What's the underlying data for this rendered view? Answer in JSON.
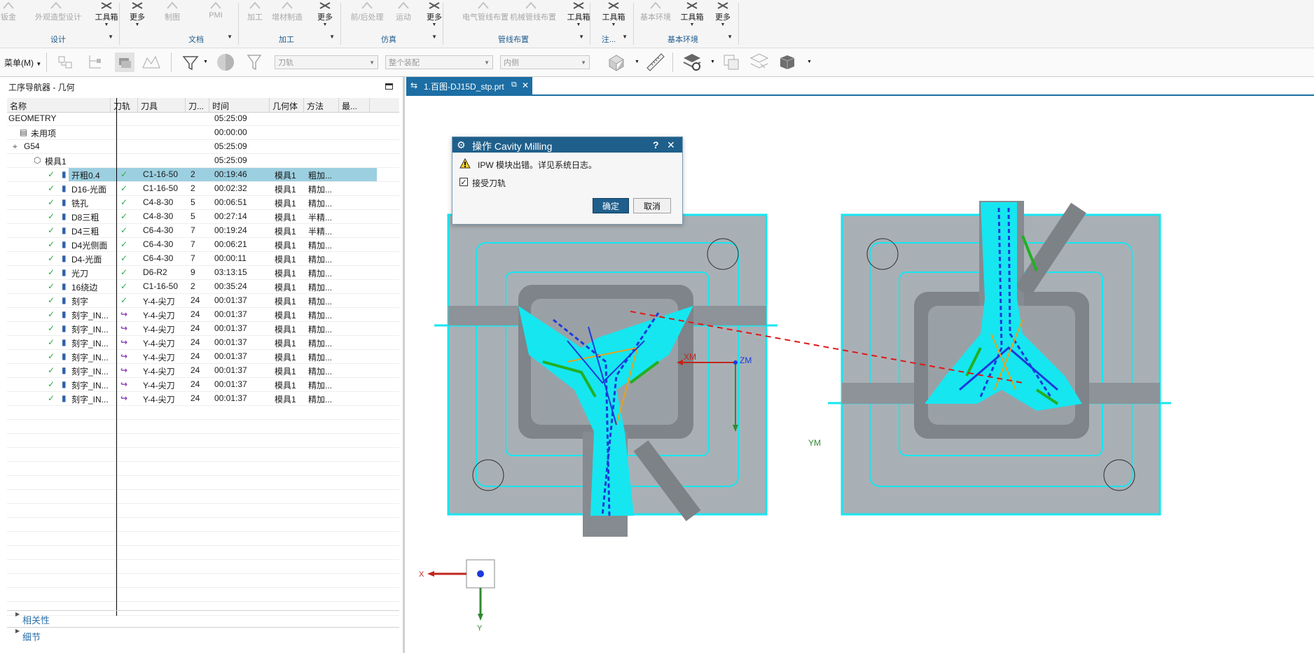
{
  "ribbon": {
    "items": [
      {
        "label": "钣金",
        "dim": true
      },
      {
        "label": "外观造型设计",
        "dim": true
      },
      {
        "label": "工具箱",
        "dim": false
      },
      {
        "label": "更多",
        "dim": false
      },
      {
        "label": "制图",
        "dim": true
      },
      {
        "label": "PMI",
        "dim": true
      },
      {
        "label": "加工",
        "dim": true
      },
      {
        "label": "增材制造",
        "dim": true
      },
      {
        "label": "更多",
        "dim": false
      },
      {
        "label": "前/后处理",
        "dim": true
      },
      {
        "label": "运动",
        "dim": true
      },
      {
        "label": "更多",
        "dim": false
      },
      {
        "label": "电气管线布置",
        "dim": true
      },
      {
        "label": "机械管线布置",
        "dim": true
      },
      {
        "label": "工具箱",
        "dim": false
      },
      {
        "label": "工具箱",
        "dim": false
      },
      {
        "label": "基本环境",
        "dim": true
      },
      {
        "label": "工具箱",
        "dim": false
      },
      {
        "label": "更多",
        "dim": false
      }
    ],
    "groups": [
      "设计",
      "文档",
      "加工",
      "仿真",
      "管线布置",
      "注...",
      "基本环境"
    ]
  },
  "toolbar": {
    "menu_label": "菜单(M)",
    "combo_toolpath": "刀轨",
    "combo_assembly": "整个装配",
    "combo_inside": "内侧"
  },
  "navigator": {
    "title": "工序导航器 - 几何",
    "columns": [
      "名称",
      "刀轨",
      "刀具",
      "刀...",
      "时间",
      "几何体",
      "方法",
      "最..."
    ],
    "rows": [
      {
        "name": "GEOMETRY",
        "path": "",
        "tool": "",
        "num": "",
        "time": "05:25:09",
        "geom": "",
        "method": ""
      },
      {
        "name": "未用项",
        "path": "",
        "tool": "",
        "num": "",
        "time": "00:00:00",
        "geom": "",
        "method": ""
      },
      {
        "name": "G54",
        "path": "",
        "tool": "",
        "num": "",
        "time": "05:25:09",
        "geom": "",
        "method": ""
      },
      {
        "name": "模具1",
        "path": "",
        "tool": "",
        "num": "",
        "time": "05:25:09",
        "geom": "",
        "method": ""
      },
      {
        "name": "开粗0.4",
        "path": "✓",
        "tool": "C1-16-50",
        "num": "2",
        "time": "00:19:46",
        "geom": "模具1",
        "method": "粗加..."
      },
      {
        "name": "D16-光面",
        "path": "✓",
        "tool": "C1-16-50",
        "num": "2",
        "time": "00:02:32",
        "geom": "模具1",
        "method": "精加..."
      },
      {
        "name": "铣孔",
        "path": "✓",
        "tool": "C4-8-30",
        "num": "5",
        "time": "00:06:51",
        "geom": "模具1",
        "method": "精加..."
      },
      {
        "name": "D8三粗",
        "path": "✓",
        "tool": "C4-8-30",
        "num": "5",
        "time": "00:27:14",
        "geom": "模具1",
        "method": "半精..."
      },
      {
        "name": "D4三粗",
        "path": "✓",
        "tool": "C6-4-30",
        "num": "7",
        "time": "00:19:24",
        "geom": "模具1",
        "method": "半精..."
      },
      {
        "name": "D4光侧面",
        "path": "✓",
        "tool": "C6-4-30",
        "num": "7",
        "time": "00:06:21",
        "geom": "模具1",
        "method": "精加..."
      },
      {
        "name": "D4-光面",
        "path": "✓",
        "tool": "C6-4-30",
        "num": "7",
        "time": "00:00:11",
        "geom": "模具1",
        "method": "精加..."
      },
      {
        "name": "光刀",
        "path": "✓",
        "tool": "D6-R2",
        "num": "9",
        "time": "03:13:15",
        "geom": "模具1",
        "method": "精加..."
      },
      {
        "name": "16绕边",
        "path": "✓",
        "tool": "C1-16-50",
        "num": "2",
        "time": "00:35:24",
        "geom": "模具1",
        "method": "精加..."
      },
      {
        "name": "刻字",
        "path": "✓",
        "tool": "Y-4-尖刀",
        "num": "24",
        "time": "00:01:37",
        "geom": "模具1",
        "method": "精加..."
      },
      {
        "name": "刻字_IN...",
        "path": "↪",
        "tool": "Y-4-尖刀",
        "num": "24",
        "time": "00:01:37",
        "geom": "模具1",
        "method": "精加..."
      },
      {
        "name": "刻字_IN...",
        "path": "↪",
        "tool": "Y-4-尖刀",
        "num": "24",
        "time": "00:01:37",
        "geom": "模具1",
        "method": "精加..."
      },
      {
        "name": "刻字_IN...",
        "path": "↪",
        "tool": "Y-4-尖刀",
        "num": "24",
        "time": "00:01:37",
        "geom": "模具1",
        "method": "精加..."
      },
      {
        "name": "刻字_IN...",
        "path": "↪",
        "tool": "Y-4-尖刀",
        "num": "24",
        "time": "00:01:37",
        "geom": "模具1",
        "method": "精加..."
      },
      {
        "name": "刻字_IN...",
        "path": "↪",
        "tool": "Y-4-尖刀",
        "num": "24",
        "time": "00:01:37",
        "geom": "模具1",
        "method": "精加..."
      },
      {
        "name": "刻字_IN...",
        "path": "↪",
        "tool": "Y-4-尖刀",
        "num": "24",
        "time": "00:01:37",
        "geom": "模具1",
        "method": "精加..."
      },
      {
        "name": "刻字_IN...",
        "path": "↪",
        "tool": "Y-4-尖刀",
        "num": "24",
        "time": "00:01:37",
        "geom": "模具1",
        "method": "精加..."
      }
    ],
    "sections": [
      "相关性",
      "细节"
    ]
  },
  "tab": {
    "label": "1.百图-DJ15D_stp.prt"
  },
  "dialog": {
    "title": "操作  Cavity Milling",
    "help": "?",
    "message": "IPW 模块出错。详见系统日志。",
    "checkbox_label": "接受刀轨",
    "checkbox_checked": true,
    "ok": "确定",
    "cancel": "取消"
  },
  "viewport": {
    "axis_xm": "XM",
    "axis_ym": "YM",
    "axis_zm": "ZM",
    "triad_x": "X",
    "triad_y": "Y"
  },
  "colors": {
    "accent": "#1f5f8b",
    "tab_blue": "#1c6ea4",
    "selected_row": "#9ccfe0",
    "cyan_toolpath": "#16e6f0",
    "check_green": "#2ea84a",
    "pending_purple": "#8a3db8"
  }
}
